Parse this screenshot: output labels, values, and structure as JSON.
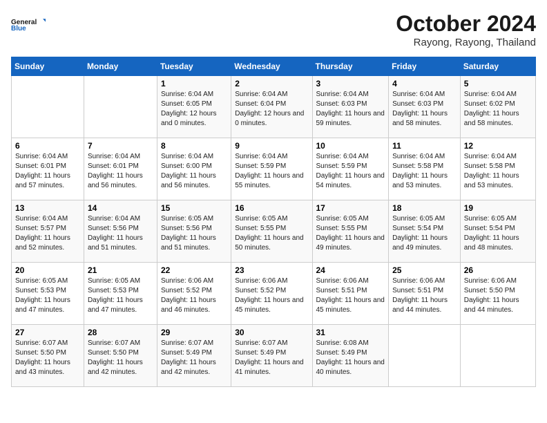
{
  "logo": {
    "line1": "General",
    "line2": "Blue"
  },
  "title": "October 2024",
  "subtitle": "Rayong, Rayong, Thailand",
  "days_header": [
    "Sunday",
    "Monday",
    "Tuesday",
    "Wednesday",
    "Thursday",
    "Friday",
    "Saturday"
  ],
  "weeks": [
    [
      {
        "day": "",
        "info": ""
      },
      {
        "day": "",
        "info": ""
      },
      {
        "day": "1",
        "sunrise": "Sunrise: 6:04 AM",
        "sunset": "Sunset: 6:05 PM",
        "daylight": "Daylight: 12 hours and 0 minutes."
      },
      {
        "day": "2",
        "sunrise": "Sunrise: 6:04 AM",
        "sunset": "Sunset: 6:04 PM",
        "daylight": "Daylight: 12 hours and 0 minutes."
      },
      {
        "day": "3",
        "sunrise": "Sunrise: 6:04 AM",
        "sunset": "Sunset: 6:03 PM",
        "daylight": "Daylight: 11 hours and 59 minutes."
      },
      {
        "day": "4",
        "sunrise": "Sunrise: 6:04 AM",
        "sunset": "Sunset: 6:03 PM",
        "daylight": "Daylight: 11 hours and 58 minutes."
      },
      {
        "day": "5",
        "sunrise": "Sunrise: 6:04 AM",
        "sunset": "Sunset: 6:02 PM",
        "daylight": "Daylight: 11 hours and 58 minutes."
      }
    ],
    [
      {
        "day": "6",
        "sunrise": "Sunrise: 6:04 AM",
        "sunset": "Sunset: 6:01 PM",
        "daylight": "Daylight: 11 hours and 57 minutes."
      },
      {
        "day": "7",
        "sunrise": "Sunrise: 6:04 AM",
        "sunset": "Sunset: 6:01 PM",
        "daylight": "Daylight: 11 hours and 56 minutes."
      },
      {
        "day": "8",
        "sunrise": "Sunrise: 6:04 AM",
        "sunset": "Sunset: 6:00 PM",
        "daylight": "Daylight: 11 hours and 56 minutes."
      },
      {
        "day": "9",
        "sunrise": "Sunrise: 6:04 AM",
        "sunset": "Sunset: 5:59 PM",
        "daylight": "Daylight: 11 hours and 55 minutes."
      },
      {
        "day": "10",
        "sunrise": "Sunrise: 6:04 AM",
        "sunset": "Sunset: 5:59 PM",
        "daylight": "Daylight: 11 hours and 54 minutes."
      },
      {
        "day": "11",
        "sunrise": "Sunrise: 6:04 AM",
        "sunset": "Sunset: 5:58 PM",
        "daylight": "Daylight: 11 hours and 53 minutes."
      },
      {
        "day": "12",
        "sunrise": "Sunrise: 6:04 AM",
        "sunset": "Sunset: 5:58 PM",
        "daylight": "Daylight: 11 hours and 53 minutes."
      }
    ],
    [
      {
        "day": "13",
        "sunrise": "Sunrise: 6:04 AM",
        "sunset": "Sunset: 5:57 PM",
        "daylight": "Daylight: 11 hours and 52 minutes."
      },
      {
        "day": "14",
        "sunrise": "Sunrise: 6:04 AM",
        "sunset": "Sunset: 5:56 PM",
        "daylight": "Daylight: 11 hours and 51 minutes."
      },
      {
        "day": "15",
        "sunrise": "Sunrise: 6:05 AM",
        "sunset": "Sunset: 5:56 PM",
        "daylight": "Daylight: 11 hours and 51 minutes."
      },
      {
        "day": "16",
        "sunrise": "Sunrise: 6:05 AM",
        "sunset": "Sunset: 5:55 PM",
        "daylight": "Daylight: 11 hours and 50 minutes."
      },
      {
        "day": "17",
        "sunrise": "Sunrise: 6:05 AM",
        "sunset": "Sunset: 5:55 PM",
        "daylight": "Daylight: 11 hours and 49 minutes."
      },
      {
        "day": "18",
        "sunrise": "Sunrise: 6:05 AM",
        "sunset": "Sunset: 5:54 PM",
        "daylight": "Daylight: 11 hours and 49 minutes."
      },
      {
        "day": "19",
        "sunrise": "Sunrise: 6:05 AM",
        "sunset": "Sunset: 5:54 PM",
        "daylight": "Daylight: 11 hours and 48 minutes."
      }
    ],
    [
      {
        "day": "20",
        "sunrise": "Sunrise: 6:05 AM",
        "sunset": "Sunset: 5:53 PM",
        "daylight": "Daylight: 11 hours and 47 minutes."
      },
      {
        "day": "21",
        "sunrise": "Sunrise: 6:05 AM",
        "sunset": "Sunset: 5:53 PM",
        "daylight": "Daylight: 11 hours and 47 minutes."
      },
      {
        "day": "22",
        "sunrise": "Sunrise: 6:06 AM",
        "sunset": "Sunset: 5:52 PM",
        "daylight": "Daylight: 11 hours and 46 minutes."
      },
      {
        "day": "23",
        "sunrise": "Sunrise: 6:06 AM",
        "sunset": "Sunset: 5:52 PM",
        "daylight": "Daylight: 11 hours and 45 minutes."
      },
      {
        "day": "24",
        "sunrise": "Sunrise: 6:06 AM",
        "sunset": "Sunset: 5:51 PM",
        "daylight": "Daylight: 11 hours and 45 minutes."
      },
      {
        "day": "25",
        "sunrise": "Sunrise: 6:06 AM",
        "sunset": "Sunset: 5:51 PM",
        "daylight": "Daylight: 11 hours and 44 minutes."
      },
      {
        "day": "26",
        "sunrise": "Sunrise: 6:06 AM",
        "sunset": "Sunset: 5:50 PM",
        "daylight": "Daylight: 11 hours and 44 minutes."
      }
    ],
    [
      {
        "day": "27",
        "sunrise": "Sunrise: 6:07 AM",
        "sunset": "Sunset: 5:50 PM",
        "daylight": "Daylight: 11 hours and 43 minutes."
      },
      {
        "day": "28",
        "sunrise": "Sunrise: 6:07 AM",
        "sunset": "Sunset: 5:50 PM",
        "daylight": "Daylight: 11 hours and 42 minutes."
      },
      {
        "day": "29",
        "sunrise": "Sunrise: 6:07 AM",
        "sunset": "Sunset: 5:49 PM",
        "daylight": "Daylight: 11 hours and 42 minutes."
      },
      {
        "day": "30",
        "sunrise": "Sunrise: 6:07 AM",
        "sunset": "Sunset: 5:49 PM",
        "daylight": "Daylight: 11 hours and 41 minutes."
      },
      {
        "day": "31",
        "sunrise": "Sunrise: 6:08 AM",
        "sunset": "Sunset: 5:49 PM",
        "daylight": "Daylight: 11 hours and 40 minutes."
      },
      {
        "day": "",
        "info": ""
      },
      {
        "day": "",
        "info": ""
      }
    ]
  ]
}
